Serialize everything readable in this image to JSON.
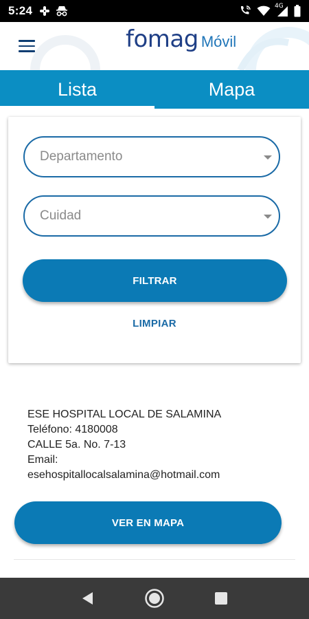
{
  "status_bar": {
    "time": "5:24",
    "network_label": "4G",
    "icons": [
      "slack-icon",
      "incognito-icon",
      "phone-wifi-icon",
      "wifi-icon",
      "signal-icon",
      "battery-icon"
    ]
  },
  "header": {
    "logo_main": "fomag",
    "logo_sub": "Móvil",
    "menu_icon": "hamburger-menu-icon"
  },
  "tabs": [
    {
      "label": "Lista",
      "active": true
    },
    {
      "label": "Mapa",
      "active": false
    }
  ],
  "filters": {
    "departamento_placeholder": "Departamento",
    "ciudad_placeholder": "Cuidad",
    "filter_button": "FILTRAR",
    "clear_button": "LIMPIAR"
  },
  "result": {
    "name": "ESE HOSPITAL LOCAL DE SALAMINA",
    "phone": "Teléfono: 4180008",
    "address": "CALLE 5a. No. 7-13",
    "email_label": "Email:",
    "email": "esehospitallocalsalamina@hotmail.com",
    "map_button": "VER EN MAPA"
  },
  "nav_bar": {
    "icons": [
      "back-icon",
      "home-icon",
      "recents-icon"
    ]
  },
  "colors": {
    "primary": "#0b7ab5",
    "tab_bar": "#0b8ec3",
    "field_border": "#1a6aa6",
    "logo": "#1f3f86"
  }
}
